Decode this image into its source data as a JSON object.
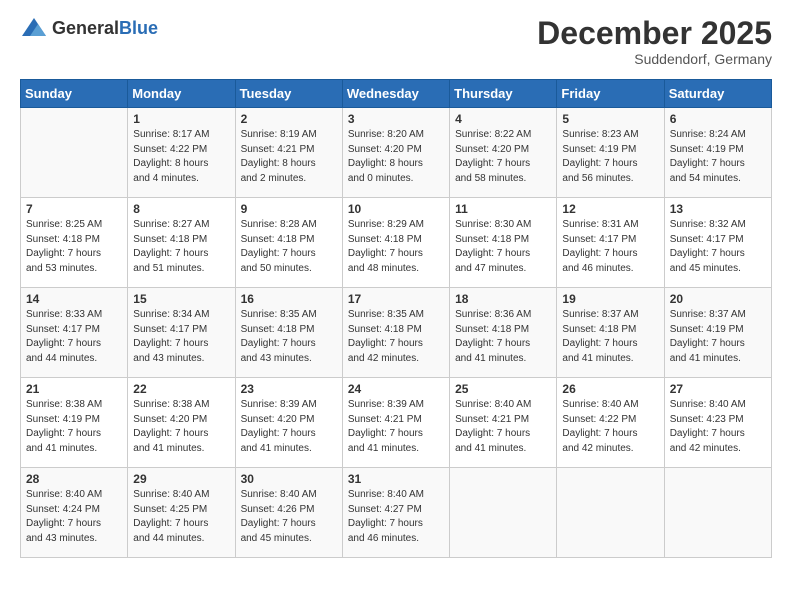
{
  "header": {
    "logo_general": "General",
    "logo_blue": "Blue",
    "month": "December 2025",
    "location": "Suddendorf, Germany"
  },
  "days_of_week": [
    "Sunday",
    "Monday",
    "Tuesday",
    "Wednesday",
    "Thursday",
    "Friday",
    "Saturday"
  ],
  "weeks": [
    [
      {
        "day": "",
        "info": ""
      },
      {
        "day": "1",
        "info": "Sunrise: 8:17 AM\nSunset: 4:22 PM\nDaylight: 8 hours\nand 4 minutes."
      },
      {
        "day": "2",
        "info": "Sunrise: 8:19 AM\nSunset: 4:21 PM\nDaylight: 8 hours\nand 2 minutes."
      },
      {
        "day": "3",
        "info": "Sunrise: 8:20 AM\nSunset: 4:20 PM\nDaylight: 8 hours\nand 0 minutes."
      },
      {
        "day": "4",
        "info": "Sunrise: 8:22 AM\nSunset: 4:20 PM\nDaylight: 7 hours\nand 58 minutes."
      },
      {
        "day": "5",
        "info": "Sunrise: 8:23 AM\nSunset: 4:19 PM\nDaylight: 7 hours\nand 56 minutes."
      },
      {
        "day": "6",
        "info": "Sunrise: 8:24 AM\nSunset: 4:19 PM\nDaylight: 7 hours\nand 54 minutes."
      }
    ],
    [
      {
        "day": "7",
        "info": "Sunrise: 8:25 AM\nSunset: 4:18 PM\nDaylight: 7 hours\nand 53 minutes."
      },
      {
        "day": "8",
        "info": "Sunrise: 8:27 AM\nSunset: 4:18 PM\nDaylight: 7 hours\nand 51 minutes."
      },
      {
        "day": "9",
        "info": "Sunrise: 8:28 AM\nSunset: 4:18 PM\nDaylight: 7 hours\nand 50 minutes."
      },
      {
        "day": "10",
        "info": "Sunrise: 8:29 AM\nSunset: 4:18 PM\nDaylight: 7 hours\nand 48 minutes."
      },
      {
        "day": "11",
        "info": "Sunrise: 8:30 AM\nSunset: 4:18 PM\nDaylight: 7 hours\nand 47 minutes."
      },
      {
        "day": "12",
        "info": "Sunrise: 8:31 AM\nSunset: 4:17 PM\nDaylight: 7 hours\nand 46 minutes."
      },
      {
        "day": "13",
        "info": "Sunrise: 8:32 AM\nSunset: 4:17 PM\nDaylight: 7 hours\nand 45 minutes."
      }
    ],
    [
      {
        "day": "14",
        "info": "Sunrise: 8:33 AM\nSunset: 4:17 PM\nDaylight: 7 hours\nand 44 minutes."
      },
      {
        "day": "15",
        "info": "Sunrise: 8:34 AM\nSunset: 4:17 PM\nDaylight: 7 hours\nand 43 minutes."
      },
      {
        "day": "16",
        "info": "Sunrise: 8:35 AM\nSunset: 4:18 PM\nDaylight: 7 hours\nand 43 minutes."
      },
      {
        "day": "17",
        "info": "Sunrise: 8:35 AM\nSunset: 4:18 PM\nDaylight: 7 hours\nand 42 minutes."
      },
      {
        "day": "18",
        "info": "Sunrise: 8:36 AM\nSunset: 4:18 PM\nDaylight: 7 hours\nand 41 minutes."
      },
      {
        "day": "19",
        "info": "Sunrise: 8:37 AM\nSunset: 4:18 PM\nDaylight: 7 hours\nand 41 minutes."
      },
      {
        "day": "20",
        "info": "Sunrise: 8:37 AM\nSunset: 4:19 PM\nDaylight: 7 hours\nand 41 minutes."
      }
    ],
    [
      {
        "day": "21",
        "info": "Sunrise: 8:38 AM\nSunset: 4:19 PM\nDaylight: 7 hours\nand 41 minutes."
      },
      {
        "day": "22",
        "info": "Sunrise: 8:38 AM\nSunset: 4:20 PM\nDaylight: 7 hours\nand 41 minutes."
      },
      {
        "day": "23",
        "info": "Sunrise: 8:39 AM\nSunset: 4:20 PM\nDaylight: 7 hours\nand 41 minutes."
      },
      {
        "day": "24",
        "info": "Sunrise: 8:39 AM\nSunset: 4:21 PM\nDaylight: 7 hours\nand 41 minutes."
      },
      {
        "day": "25",
        "info": "Sunrise: 8:40 AM\nSunset: 4:21 PM\nDaylight: 7 hours\nand 41 minutes."
      },
      {
        "day": "26",
        "info": "Sunrise: 8:40 AM\nSunset: 4:22 PM\nDaylight: 7 hours\nand 42 minutes."
      },
      {
        "day": "27",
        "info": "Sunrise: 8:40 AM\nSunset: 4:23 PM\nDaylight: 7 hours\nand 42 minutes."
      }
    ],
    [
      {
        "day": "28",
        "info": "Sunrise: 8:40 AM\nSunset: 4:24 PM\nDaylight: 7 hours\nand 43 minutes."
      },
      {
        "day": "29",
        "info": "Sunrise: 8:40 AM\nSunset: 4:25 PM\nDaylight: 7 hours\nand 44 minutes."
      },
      {
        "day": "30",
        "info": "Sunrise: 8:40 AM\nSunset: 4:26 PM\nDaylight: 7 hours\nand 45 minutes."
      },
      {
        "day": "31",
        "info": "Sunrise: 8:40 AM\nSunset: 4:27 PM\nDaylight: 7 hours\nand 46 minutes."
      },
      {
        "day": "",
        "info": ""
      },
      {
        "day": "",
        "info": ""
      },
      {
        "day": "",
        "info": ""
      }
    ]
  ]
}
